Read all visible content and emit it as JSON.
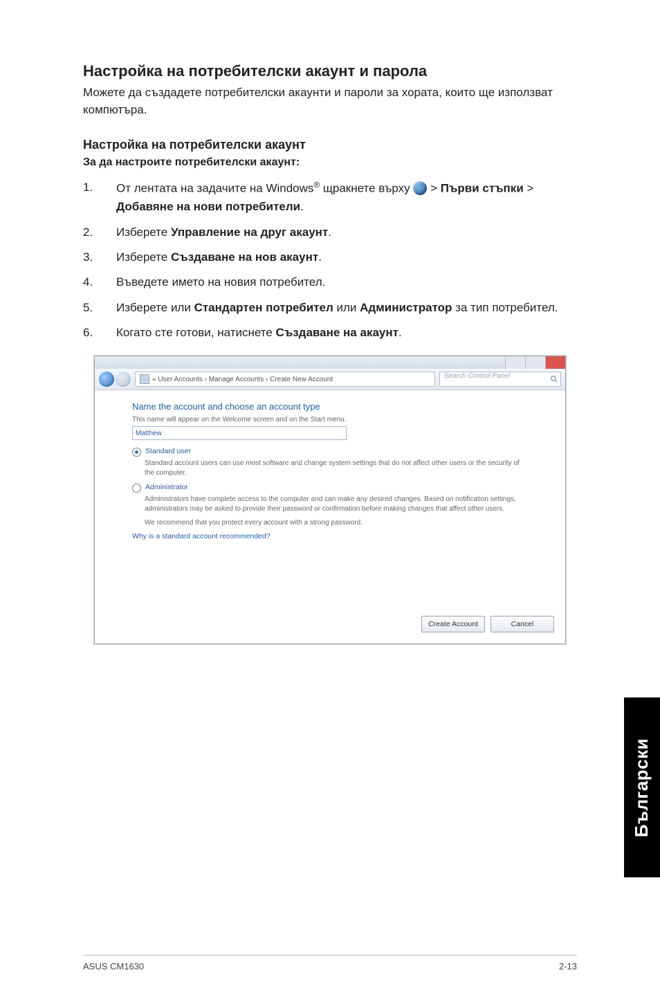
{
  "heading": "Настройка на потребителски акаунт и парола",
  "intro": "Можете да създадете потребителски акаунти и пароли за хората, които ще използват компютъра.",
  "sub_heading": "Настройка на потребителски акаунт",
  "sub_sub": "За да настроите потребителски акаунт:",
  "steps": {
    "s1a": "От лентата на задачите на Windows",
    "s1reg": "®",
    "s1b": " щракнете върху ",
    "s1c": " > ",
    "s1_bold1": "Първи стъпки",
    "s1d": " > ",
    "s1_bold2": "Добавяне на нови потребители",
    "s1e": ".",
    "s2a": "Изберете ",
    "s2_bold": "Управление на друг акаунт",
    "s2b": ".",
    "s3a": "Изберете ",
    "s3_bold": "Създаване на нов акаунт",
    "s3b": ".",
    "s4": "Въведете името на новия потребител.",
    "s5a": "Изберете или ",
    "s5_bold1": "Стандартен потребител",
    "s5b": " или ",
    "s5_bold2": "Администратор",
    "s5c": " за тип потребител.",
    "s6a": "Когато сте готови, натиснете ",
    "s6_bold": "Създаване на акаунт",
    "s6b": "."
  },
  "screenshot": {
    "breadcrumb": "« User Accounts › Manage Accounts › Create New Account",
    "search_placeholder": "Search Control Panel",
    "title": "Name the account and choose an account type",
    "subtitle": "This name will appear on the Welcome screen and on the Start menu.",
    "input_value": "Matthew",
    "opt_standard": "Standard user",
    "opt_standard_desc": "Standard account users can use most software and change system settings that do not affect other users or the security of the computer.",
    "opt_admin": "Administrator",
    "opt_admin_desc": "Administrators have complete access to the computer and can make any desired changes. Based on notification settings, administrators may be asked to provide their password or confirmation before making changes that affect other users.",
    "recommend": "We recommend that you protect every account with a strong password.",
    "why_link": "Why is a standard account recommended?",
    "btn_create": "Create Account",
    "btn_cancel": "Cancel"
  },
  "side_tab": "Български",
  "footer_left": "ASUS CM1630",
  "footer_right": "2-13"
}
